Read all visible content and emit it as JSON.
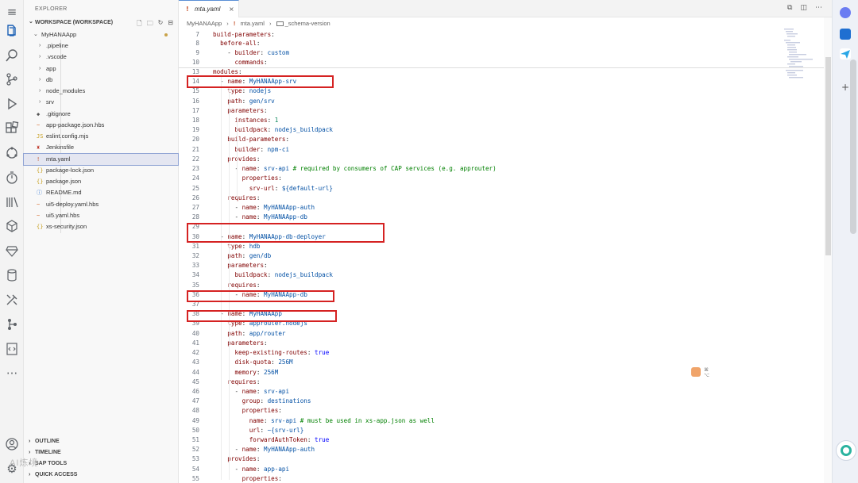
{
  "explorer": {
    "title": "EXPLORER",
    "workspace_label": "WORKSPACE (WORKSPACE)",
    "project": "MyHANAApp",
    "items": [
      {
        "label": ".pipeline",
        "kind": "folder"
      },
      {
        "label": ".vscode",
        "kind": "folder"
      },
      {
        "label": "app",
        "kind": "folder"
      },
      {
        "label": "db",
        "kind": "folder"
      },
      {
        "label": "node_modules",
        "kind": "folder"
      },
      {
        "label": "srv",
        "kind": "folder"
      },
      {
        "label": ".gitignore",
        "kind": "file",
        "icon": "◆"
      },
      {
        "label": "app-package.json.hbs",
        "kind": "file",
        "icon": "~"
      },
      {
        "label": "eslint.config.mjs",
        "kind": "file",
        "icon": "JS"
      },
      {
        "label": "Jenkinsfile",
        "kind": "file",
        "icon": "♜"
      },
      {
        "label": "mta.yaml",
        "kind": "file",
        "icon": "!"
      },
      {
        "label": "package-lock.json",
        "kind": "file",
        "icon": "{}"
      },
      {
        "label": "package.json",
        "kind": "file",
        "icon": "{}"
      },
      {
        "label": "README.md",
        "kind": "file",
        "icon": "ⓘ"
      },
      {
        "label": "ui5-deploy.yaml.hbs",
        "kind": "file",
        "icon": "~"
      },
      {
        "label": "ui5.yaml.hbs",
        "kind": "file",
        "icon": "~"
      },
      {
        "label": "xs-security.json",
        "kind": "file",
        "icon": "{}"
      }
    ],
    "selected_index": 10,
    "bottom_sections": [
      "OUTLINE",
      "TIMELINE",
      "SAP TOOLS",
      "QUICK ACCESS"
    ]
  },
  "editor": {
    "tab_label": "mta.yaml",
    "tab_icon": "!",
    "close_glyph": "×",
    "breadcrumb": [
      "MyHANAApp",
      "mta.yaml",
      "_schema-version"
    ],
    "lines": [
      {
        "n": "7",
        "text": "build-parameters:"
      },
      {
        "n": "8",
        "text": "  before-all:"
      },
      {
        "n": "9",
        "text": "    - builder: custom"
      },
      {
        "n": "10",
        "text": "      commands:"
      },
      {
        "n": "13",
        "text": "modules:"
      },
      {
        "n": "14",
        "text": "  - name: MyHANAApp-srv"
      },
      {
        "n": "15",
        "text": "    type: nodejs"
      },
      {
        "n": "16",
        "text": "    path: gen/srv"
      },
      {
        "n": "17",
        "text": "    parameters:"
      },
      {
        "n": "18",
        "text": "      instances: 1"
      },
      {
        "n": "19",
        "text": "      buildpack: nodejs_buildpack"
      },
      {
        "n": "20",
        "text": "    build-parameters:"
      },
      {
        "n": "21",
        "text": "      builder: npm-ci"
      },
      {
        "n": "22",
        "text": "    provides:"
      },
      {
        "n": "23",
        "text": "      - name: srv-api # required by consumers of CAP services (e.g. approuter)"
      },
      {
        "n": "24",
        "text": "        properties:"
      },
      {
        "n": "25",
        "text": "          srv-url: ${default-url}"
      },
      {
        "n": "26",
        "text": "    requires:"
      },
      {
        "n": "27",
        "text": "      - name: MyHANAApp-auth"
      },
      {
        "n": "28",
        "text": "      - name: MyHANAApp-db"
      },
      {
        "n": "29",
        "text": ""
      },
      {
        "n": "30",
        "text": "  - name: MyHANAApp-db-deployer"
      },
      {
        "n": "31",
        "text": "    type: hdb"
      },
      {
        "n": "32",
        "text": "    path: gen/db"
      },
      {
        "n": "33",
        "text": "    parameters:"
      },
      {
        "n": "34",
        "text": "      buildpack: nodejs_buildpack"
      },
      {
        "n": "35",
        "text": "    requires:"
      },
      {
        "n": "36",
        "text": "      - name: MyHANAApp-db"
      },
      {
        "n": "37",
        "text": ""
      },
      {
        "n": "38",
        "text": "  - name: MyHANAApp"
      },
      {
        "n": "39",
        "text": "    type: approuter.nodejs"
      },
      {
        "n": "40",
        "text": "    path: app/router"
      },
      {
        "n": "41",
        "text": "    parameters:"
      },
      {
        "n": "42",
        "text": "      keep-existing-routes: true"
      },
      {
        "n": "43",
        "text": "      disk-quota: 256M"
      },
      {
        "n": "44",
        "text": "      memory: 256M"
      },
      {
        "n": "45",
        "text": "    requires:"
      },
      {
        "n": "46",
        "text": "      - name: srv-api"
      },
      {
        "n": "47",
        "text": "        group: destinations"
      },
      {
        "n": "48",
        "text": "        properties:"
      },
      {
        "n": "49",
        "text": "          name: srv-api # must be used in xs-app.json as well"
      },
      {
        "n": "50",
        "text": "          url: ~{srv-url}"
      },
      {
        "n": "51",
        "text": "          forwardAuthToken: true"
      },
      {
        "n": "52",
        "text": "      - name: MyHANAApp-auth"
      },
      {
        "n": "53",
        "text": "    provides:"
      },
      {
        "n": "54",
        "text": "      - name: app-api"
      },
      {
        "n": "55",
        "text": "        properties:"
      }
    ]
  },
  "watermark": "AI炼境",
  "colors": {
    "highlight_box": "#d52222",
    "accent": "#5b8fd6"
  }
}
